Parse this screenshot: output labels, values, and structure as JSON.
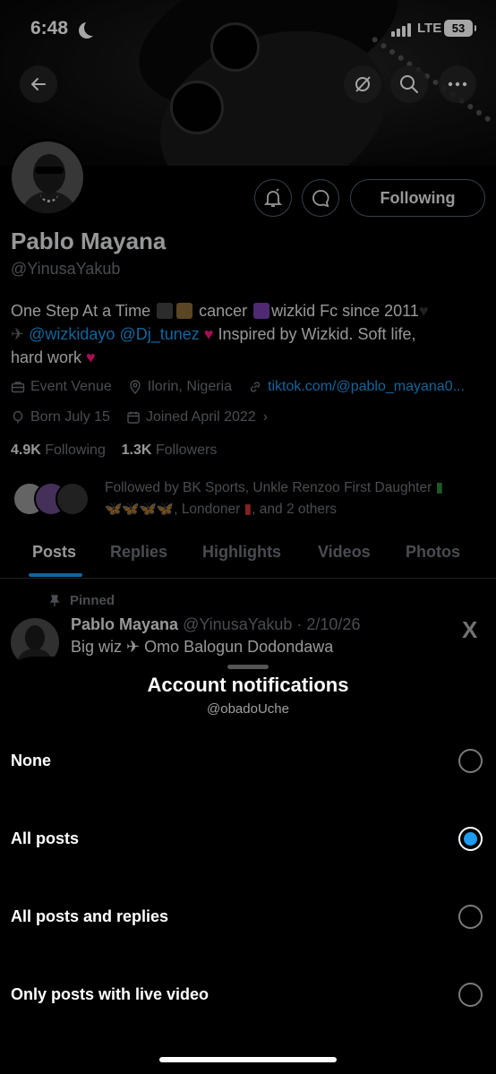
{
  "status_bar": {
    "time": "6:48",
    "network": "LTE",
    "battery": "53"
  },
  "profile": {
    "name": "Pablo Mayana",
    "handle": "@YinusaYakub",
    "following_button": "Following",
    "bio_line1_a": "One Step At a Time ",
    "bio_line1_b": " cancer ",
    "bio_line1_c": "wizkid Fc since 2011",
    "bio_mention1": "@wizkidayo",
    "bio_mention2": "@Dj_tunez",
    "bio_line2_tail": " Inspired by Wizkid. Soft life,",
    "bio_line3": "hard work",
    "category": "Event Venue",
    "location": "Ilorin, Nigeria",
    "website": "tiktok.com/@pablo_mayana0...",
    "born": "Born July 15",
    "joined": "Joined April 2022",
    "following_count": "4.9K",
    "following_label": "Following",
    "followers_count": "1.3K",
    "followers_label": "Followers",
    "followed_by_a": "Followed by BK Sports, Unkle Renzoo First Daughter ",
    "followed_by_b": ", Londoner ",
    "followed_by_c": ", and 2 others"
  },
  "tabs": [
    "Posts",
    "Replies",
    "Highlights",
    "Videos",
    "Photos"
  ],
  "pinned_post": {
    "pinned_label": "Pinned",
    "author": "Pablo Mayana",
    "handle_date": "@YinusaYakub · 2/10/26",
    "text": "Big wiz ✈ Omo Balogun Dodondawa"
  },
  "sheet": {
    "title": "Account notifications",
    "subtitle": "@obadoUche",
    "options": [
      {
        "label": "None",
        "selected": false
      },
      {
        "label": "All posts",
        "selected": true
      },
      {
        "label": "All posts and replies",
        "selected": false
      },
      {
        "label": "Only posts with live video",
        "selected": false
      }
    ]
  },
  "colors": {
    "accent": "#1d9bf0",
    "muted": "#71767b",
    "text": "#e7e9ea",
    "background": "#000000"
  },
  "icons": [
    "back-arrow-icon",
    "grok-icon",
    "search-icon",
    "more-icon",
    "bell-icon",
    "message-icon",
    "briefcase-icon",
    "location-icon",
    "link-icon",
    "balloon-icon",
    "calendar-icon",
    "pin-icon",
    "x-logo-icon"
  ]
}
